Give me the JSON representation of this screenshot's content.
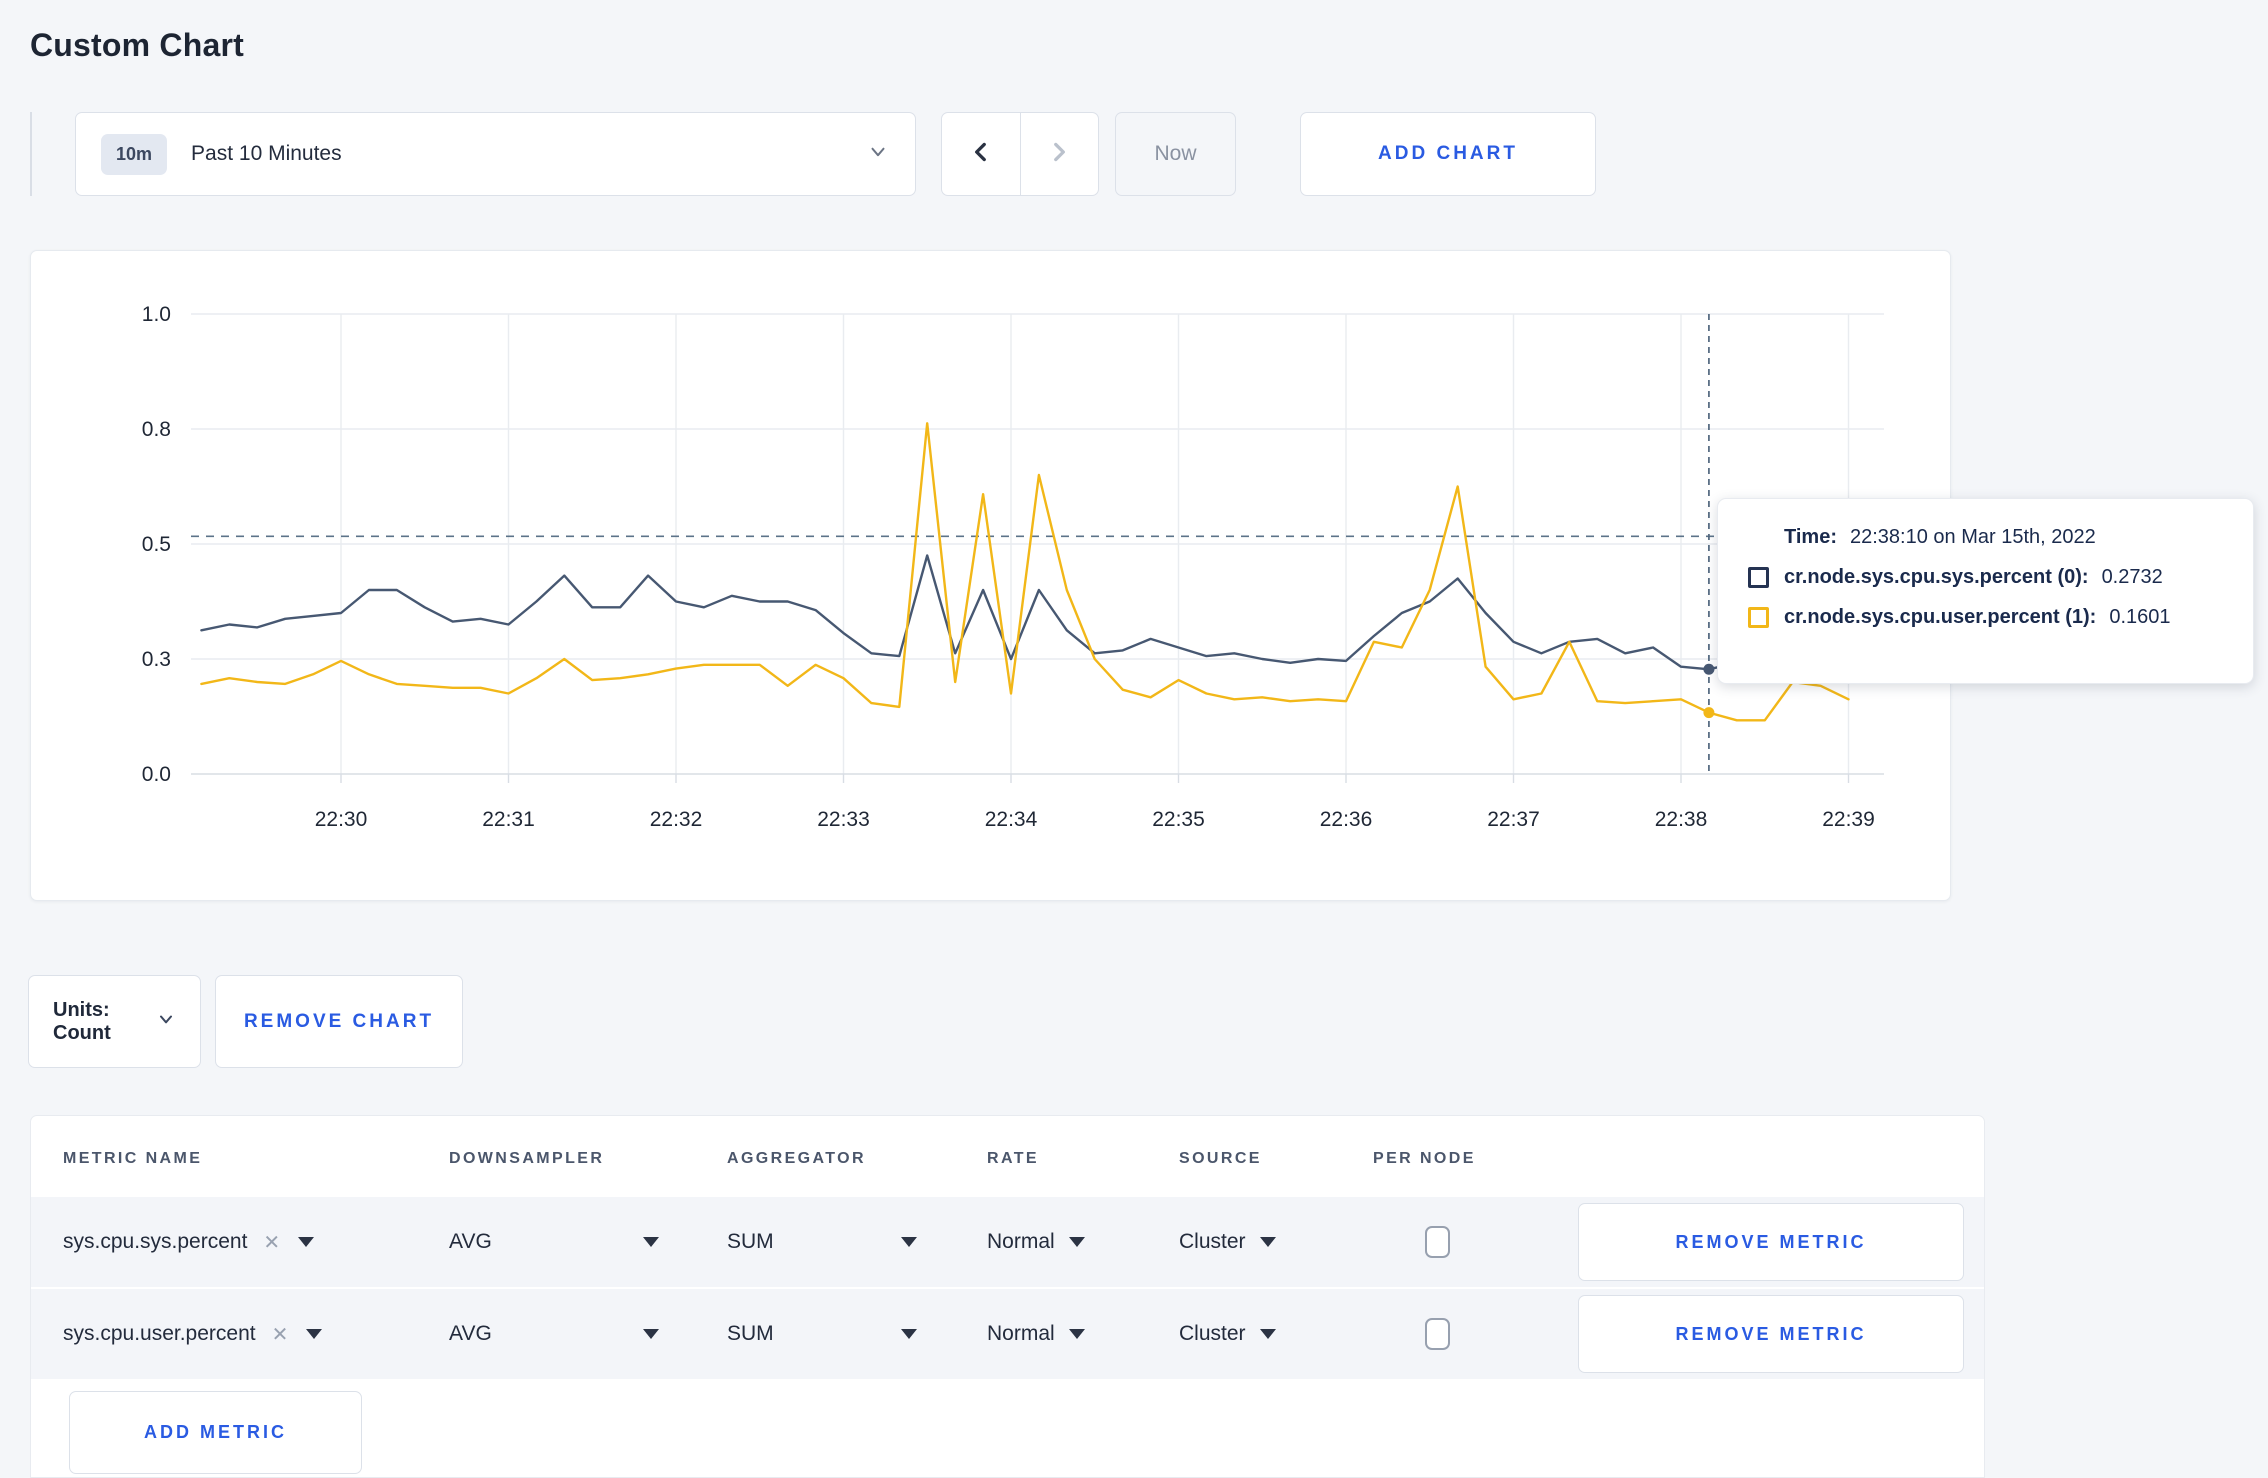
{
  "page": {
    "title": "Custom Chart"
  },
  "toolbar": {
    "time_window_badge": "10m",
    "time_window_label": "Past 10 Minutes",
    "now_label": "Now",
    "add_chart_label": "ADD CHART"
  },
  "chart_controls": {
    "units_label": "Units: Count",
    "remove_chart_label": "REMOVE CHART"
  },
  "tooltip": {
    "time_label": "Time:",
    "time_value": "22:38:10 on Mar 15th, 2022",
    "series": [
      {
        "name": "cr.node.sys.cpu.sys.percent (0):",
        "value": "0.2732",
        "color": "#253352"
      },
      {
        "name": "cr.node.sys.cpu.user.percent (1):",
        "value": "0.1601",
        "color": "#f2b718"
      }
    ]
  },
  "chart_data": {
    "type": "line",
    "title": "",
    "xlabel": "",
    "ylabel": "",
    "x_start": "22:29:10",
    "x_interval_seconds": 10,
    "x_ticks": [
      "22:30",
      "22:31",
      "22:32",
      "22:33",
      "22:34",
      "22:35",
      "22:36",
      "22:37",
      "22:38",
      "22:39"
    ],
    "y_ticks": [
      0.0,
      0.3,
      0.5,
      0.8,
      1.0
    ],
    "ylim": [
      0.0,
      1.0
    ],
    "grid": true,
    "legend_position": "none",
    "crosshair": {
      "time": "22:38:10",
      "x_index": 54,
      "guide_value": 0.52
    },
    "series": [
      {
        "name": "cr.node.sys.cpu.sys.percent",
        "color": "#475872",
        "values": [
          0.35,
          0.36,
          0.355,
          0.37,
          0.375,
          0.38,
          0.42,
          0.42,
          0.39,
          0.365,
          0.37,
          0.36,
          0.4,
          0.445,
          0.39,
          0.39,
          0.445,
          0.4,
          0.39,
          0.41,
          0.4,
          0.4,
          0.385,
          0.345,
          0.31,
          0.305,
          0.48,
          0.31,
          0.42,
          0.3,
          0.42,
          0.35,
          0.31,
          0.315,
          0.335,
          0.32,
          0.305,
          0.31,
          0.3,
          0.29,
          0.3,
          0.295,
          0.34,
          0.38,
          0.4,
          0.44,
          0.38,
          0.33,
          0.31,
          0.33,
          0.335,
          0.31,
          0.32,
          0.28,
          0.2732,
          0.29,
          0.3,
          0.31,
          0.33,
          0.3
        ]
      },
      {
        "name": "cr.node.sys.cpu.user.percent",
        "color": "#f2b718",
        "values": [
          0.235,
          0.25,
          0.24,
          0.235,
          0.26,
          0.295,
          0.26,
          0.235,
          0.23,
          0.225,
          0.225,
          0.21,
          0.25,
          0.3,
          0.245,
          0.25,
          0.26,
          0.275,
          0.285,
          0.285,
          0.285,
          0.23,
          0.285,
          0.25,
          0.185,
          0.175,
          0.81,
          0.24,
          0.63,
          0.21,
          0.68,
          0.42,
          0.3,
          0.22,
          0.2,
          0.245,
          0.21,
          0.195,
          0.2,
          0.19,
          0.195,
          0.19,
          0.33,
          0.32,
          0.42,
          0.65,
          0.28,
          0.195,
          0.21,
          0.33,
          0.19,
          0.185,
          0.19,
          0.195,
          0.1601,
          0.14,
          0.14,
          0.24,
          0.23,
          0.195
        ]
      }
    ]
  },
  "metrics_table": {
    "headers": [
      "METRIC NAME",
      "DOWNSAMPLER",
      "AGGREGATOR",
      "RATE",
      "SOURCE",
      "PER NODE"
    ],
    "rows": [
      {
        "metric": "sys.cpu.sys.percent",
        "downsampler": "AVG",
        "aggregator": "SUM",
        "rate": "Normal",
        "source": "Cluster",
        "per_node": false
      },
      {
        "metric": "sys.cpu.user.percent",
        "downsampler": "AVG",
        "aggregator": "SUM",
        "rate": "Normal",
        "source": "Cluster",
        "per_node": false
      }
    ],
    "remove_metric_label": "REMOVE METRIC",
    "add_metric_label": "ADD METRIC"
  },
  "colors": {
    "accent_blue": "#2a5be2",
    "series_sys": "#475872",
    "series_user": "#f2b718",
    "grid": "#e9ecf0"
  }
}
